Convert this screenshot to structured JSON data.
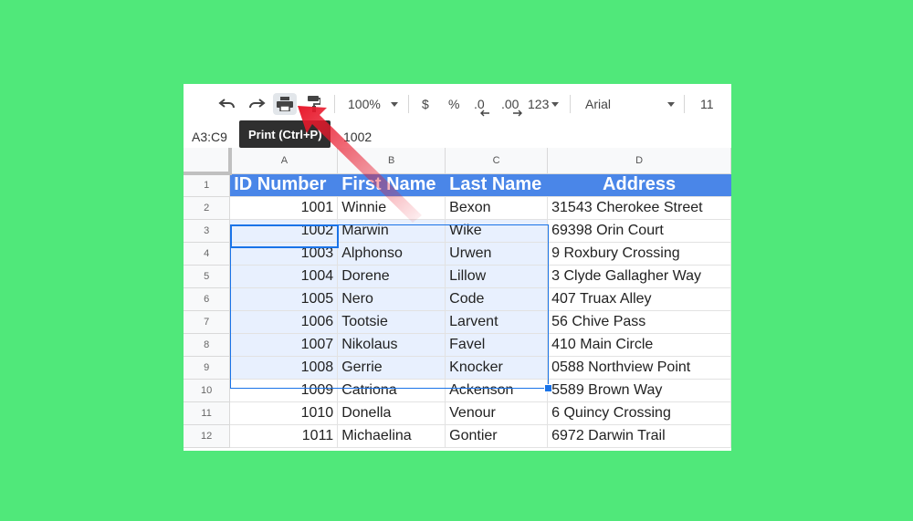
{
  "toolbar": {
    "undo_icon": "undo-icon",
    "redo_icon": "redo-icon",
    "print_icon": "print-icon",
    "paint_format_icon": "paint-format-icon",
    "zoom": "100%",
    "currency": "$",
    "percent": "%",
    "decrease_decimal": ".0",
    "increase_decimal": ".00",
    "more_formats": "123",
    "font": "Arial",
    "font_size": "11"
  },
  "tooltip": "Print (Ctrl+P)",
  "formula_bar": {
    "name_box": "A3:C9",
    "value": "1002"
  },
  "columns": [
    "A",
    "B",
    "C",
    "D"
  ],
  "header_row": {
    "row": "1",
    "cells": [
      "ID Number",
      "First Name",
      "Last Name",
      "Address"
    ]
  },
  "rows": [
    {
      "row": "2",
      "cells": [
        "1001",
        "Winnie",
        "Bexon",
        "31543 Cherokee Street"
      ]
    },
    {
      "row": "3",
      "cells": [
        "1002",
        "Marwin",
        "Wike",
        "69398 Orin Court"
      ]
    },
    {
      "row": "4",
      "cells": [
        "1003",
        "Alphonso",
        "Urwen",
        "9 Roxbury Crossing"
      ]
    },
    {
      "row": "5",
      "cells": [
        "1004",
        "Dorene",
        "Lillow",
        "3 Clyde Gallagher Way"
      ]
    },
    {
      "row": "6",
      "cells": [
        "1005",
        "Nero",
        "Code",
        "407 Truax Alley"
      ]
    },
    {
      "row": "7",
      "cells": [
        "1006",
        "Tootsie",
        "Larvent",
        "56 Chive Pass"
      ]
    },
    {
      "row": "8",
      "cells": [
        "1007",
        "Nikolaus",
        "Favel",
        "410 Main Circle"
      ]
    },
    {
      "row": "9",
      "cells": [
        "1008",
        "Gerrie",
        "Knocker",
        "0588 Northview Point"
      ]
    },
    {
      "row": "10",
      "cells": [
        "1009",
        "Catriona",
        "Ackenson",
        "5589 Brown Way"
      ]
    },
    {
      "row": "11",
      "cells": [
        "1010",
        "Donella",
        "Venour",
        "6 Quincy Crossing"
      ]
    },
    {
      "row": "12",
      "cells": [
        "1011",
        "Michaelina",
        "Gontier",
        "6972 Darwin Trail"
      ]
    }
  ],
  "colors": {
    "background": "#50e87a",
    "header_fill": "#4a86e8",
    "selection": "#e8f0fe",
    "arrow": "#e8192c"
  }
}
